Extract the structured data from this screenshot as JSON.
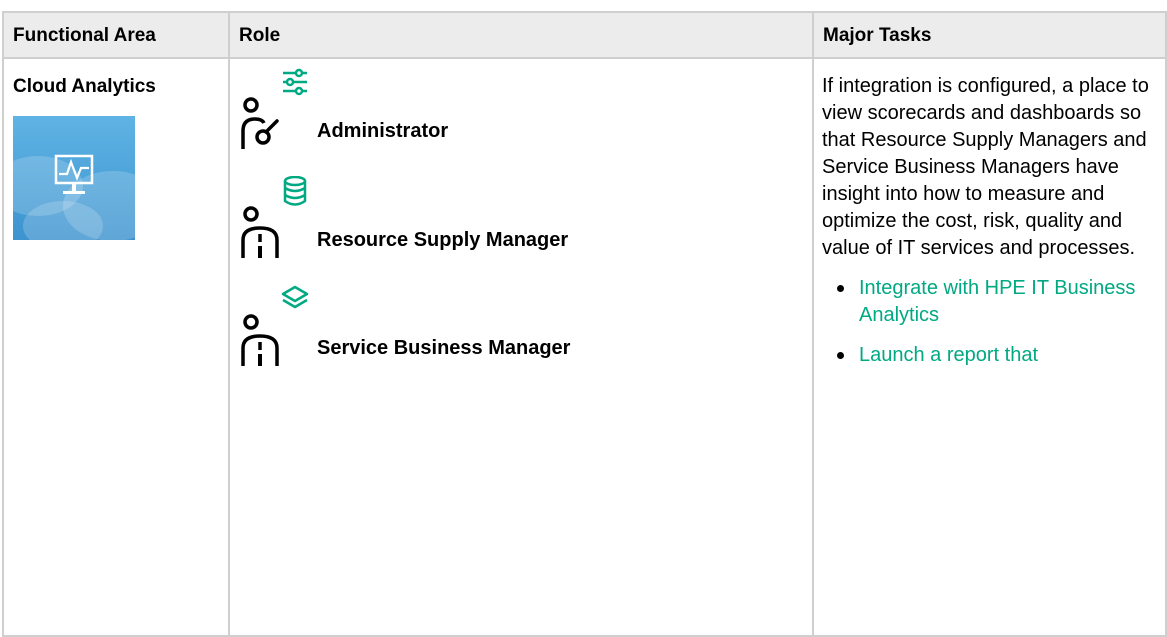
{
  "table": {
    "headers": {
      "functional_area": "Functional Area",
      "role": "Role",
      "major_tasks": "Major Tasks"
    },
    "row": {
      "functional_area": "Cloud Analytics",
      "functional_area_icon": "monitor-chart-icon",
      "roles": [
        {
          "label": "Administrator",
          "icon": "administrator-icon",
          "badge_icon": "sliders-icon"
        },
        {
          "label": "Resource Supply Manager",
          "icon": "manager-icon",
          "badge_icon": "database-icon"
        },
        {
          "label": "Service Business Manager",
          "icon": "manager-icon",
          "badge_icon": "layers-icon"
        }
      ],
      "major_tasks_description": "If integration is configured, a place to view scorecards and dashboards so that Resource Supply Managers and Service Business Managers have insight into how to measure and optimize the cost, risk, quality and value of IT services and processes.",
      "task_links": [
        "Integrate with HPE IT Business Analytics",
        "Launch a report that"
      ]
    }
  },
  "colors": {
    "header_bg": "#ececec",
    "border": "#cfcfcf",
    "accent_green": "#01a982",
    "link_green": "#01a982",
    "tile_blue": "#4aa2d9"
  }
}
